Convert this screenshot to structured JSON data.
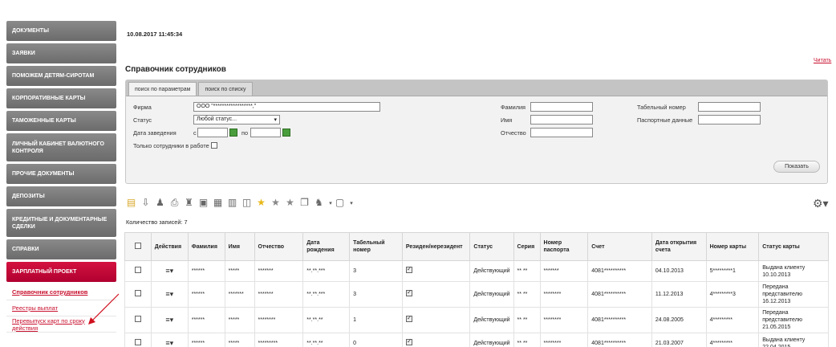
{
  "sidebar": {
    "items": [
      {
        "label": "ДОКУМЕНТЫ"
      },
      {
        "label": "ЗАЯВКИ"
      },
      {
        "label": "ПОМОЖЕМ ДЕТЯМ-СИРОТАМ"
      },
      {
        "label": "КОРПОРАТИВНЫЕ КАРТЫ"
      },
      {
        "label": "ТАМОЖЕННЫЕ КАРТЫ"
      },
      {
        "label": "ЛИЧНЫЙ КАБИНЕТ ВАЛЮТНОГО КОНТРОЛЯ"
      },
      {
        "label": "ПРОЧИЕ ДОКУМЕНТЫ"
      },
      {
        "label": "ДЕПОЗИТЫ"
      },
      {
        "label": "КРЕДИТНЫЕ И ДОКУМЕНТАРНЫЕ СДЕЛКИ"
      },
      {
        "label": "СПРАВКИ"
      },
      {
        "label": "ЗАРПЛАТНЫЙ ПРОЕКТ"
      }
    ],
    "subitems": [
      {
        "label": "Справочник сотрудников"
      },
      {
        "label": "Реестры выплат"
      },
      {
        "label": "Перевыпуск карт по сроку действия"
      }
    ]
  },
  "header": {
    "timestamp": "10.08.2017 11:45:34",
    "title": "Справочник сотрудников",
    "read_link": "Читать"
  },
  "filter": {
    "tabs": [
      "поиск по параметрам",
      "поиск по списку"
    ],
    "firm_label": "Фирма",
    "firm_value": "ООО \"******************,\"",
    "status_label": "Статус",
    "status_value": "Любой статус...",
    "hire_date_label": "Дата заведения",
    "from_label": "с",
    "to_label": "по",
    "only_working_label": "Только сотрудники в работе",
    "lastname_label": "Фамилия",
    "firstname_label": "Имя",
    "patronymic_label": "Отчество",
    "tab_number_label": "Табельный номер",
    "passport_label": "Паспортные данные",
    "show_button": "Показать"
  },
  "toolbar": {
    "record_count": "Количество записей: 7"
  },
  "table": {
    "headers": [
      "",
      "Действия",
      "Фамилия",
      "Имя",
      "Отчество",
      "Дата рождения",
      "Табельный номер",
      "Резиден/нерезидент",
      "Статус",
      "Серия",
      "Номер паспорта",
      "Счет",
      "Дата открытия счета",
      "Номер карты",
      "Статус карты"
    ],
    "rows": [
      {
        "lastname": "******",
        "firstname": "*****",
        "patronymic": "*******",
        "birth": "**.**.***",
        "tab": "3",
        "status": "Действующий",
        "series": "** **",
        "passport": "*******",
        "account": "4081**********",
        "opened": "04.10.2013",
        "card": "5*********1",
        "card_status": "Выдана клиенту 10.10.2013"
      },
      {
        "lastname": "******",
        "firstname": "*******",
        "patronymic": "*******",
        "birth": "**.**.***",
        "tab": "3",
        "status": "Действующий",
        "series": "** **",
        "passport": "********",
        "account": "4081**********",
        "opened": "11.12.2013",
        "card": "4*********3",
        "card_status": "Передана представителю 16.12.2013"
      },
      {
        "lastname": "******",
        "firstname": "*****",
        "patronymic": "********",
        "birth": "**.**.**",
        "tab": "1",
        "status": "Действующий",
        "series": "** **",
        "passport": "********",
        "account": "4081**********",
        "opened": "24.08.2005",
        "card": "4*********",
        "card_status": "Передана представителю 21.05.2015"
      },
      {
        "lastname": "******",
        "firstname": "*****",
        "patronymic": "*********",
        "birth": "**.**.**",
        "tab": "0",
        "status": "Действующий",
        "series": "** **",
        "passport": "********",
        "account": "4081**********",
        "opened": "21.03.2007",
        "card": "4*********",
        "card_status": "Выдана клиенту 22.04.2015"
      }
    ]
  }
}
